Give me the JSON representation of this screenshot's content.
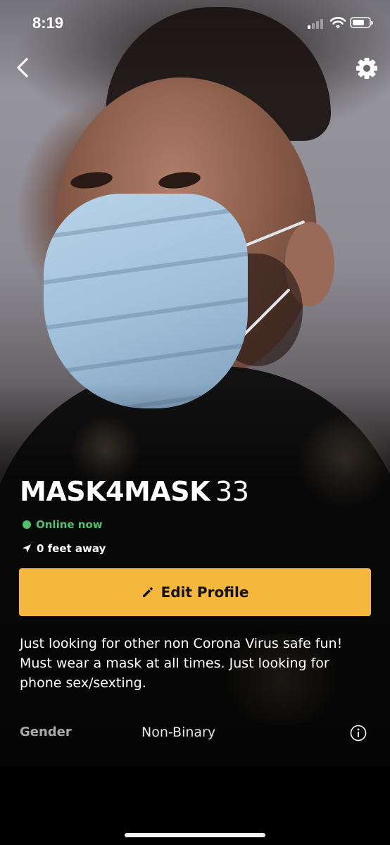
{
  "status_bar": {
    "time": "8:19"
  },
  "colors": {
    "accent": "#F5B73C",
    "online": "#4CC26A"
  },
  "nav": {
    "back_icon": "chevron-left-icon",
    "settings_icon": "gear-icon"
  },
  "profile": {
    "display_name": "MASK4MASK",
    "age": "33",
    "online_status": "Online now",
    "distance": "0 feet away"
  },
  "actions": {
    "edit_profile_label": "Edit Profile",
    "edit_icon": "pencil-icon"
  },
  "about": {
    "bio": "Just looking for other non Corona Virus safe fun! Must wear a mask at all times. Just looking for phone sex/sexting."
  },
  "details": [
    {
      "label": "Gender",
      "value": "Non-Binary"
    }
  ]
}
